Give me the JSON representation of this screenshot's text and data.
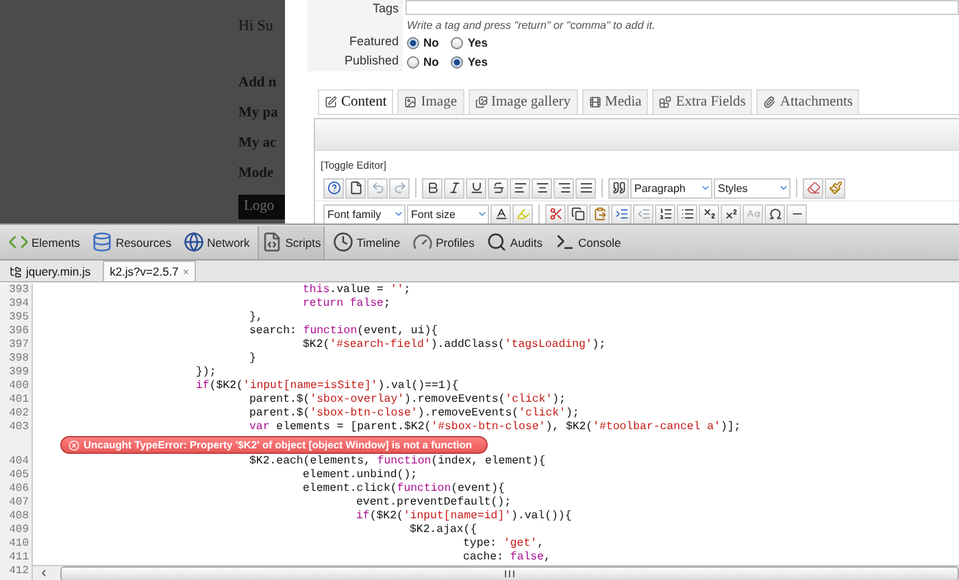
{
  "background_page": {
    "greeting": "Hi Su",
    "links": [
      "Add n",
      "My pa",
      "My ac",
      "Mode"
    ],
    "logout_button": "Logo"
  },
  "item_form": {
    "tags": {
      "label": "Tags",
      "hint": "Write a tag and press \"return\" or \"comma\" to add it."
    },
    "radio_groups": [
      {
        "label": "Featured",
        "options": [
          {
            "label": "No",
            "selected": true
          },
          {
            "label": "Yes",
            "selected": false
          }
        ]
      },
      {
        "label": "Published",
        "options": [
          {
            "label": "No",
            "selected": false
          },
          {
            "label": "Yes",
            "selected": true
          }
        ]
      }
    ],
    "tabs": [
      {
        "label": "Content",
        "selected": true
      },
      {
        "label": "Image",
        "selected": false
      },
      {
        "label": "Image gallery",
        "selected": false
      },
      {
        "label": "Media",
        "selected": false
      },
      {
        "label": "Extra Fields",
        "selected": false
      },
      {
        "label": "Attachments",
        "selected": false
      }
    ],
    "editor": {
      "toggle_link": "[Toggle Editor]",
      "format_select": "Paragraph",
      "styles_select": "Styles",
      "font_family_select": "Font family",
      "font_size_select": "Font size"
    }
  },
  "devtools": {
    "panels": [
      {
        "label": "Elements",
        "selected": false
      },
      {
        "label": "Resources",
        "selected": false
      },
      {
        "label": "Network",
        "selected": false
      },
      {
        "label": "Scripts",
        "selected": true
      },
      {
        "label": "Timeline",
        "selected": false
      },
      {
        "label": "Profiles",
        "selected": false
      },
      {
        "label": "Audits",
        "selected": false
      },
      {
        "label": "Console",
        "selected": false
      }
    ],
    "files": [
      {
        "name": "jquery.min.js",
        "selected": false
      },
      {
        "name": "k2.js?v=2.5.7",
        "selected": true,
        "close": "×"
      }
    ],
    "code_lines": [
      {
        "number": "393",
        "tokens": [
          {
            "kind": "keyword",
            "text": "\t\t\t\t\tthis"
          },
          {
            "kind": "plain",
            "text": ".value = "
          },
          {
            "kind": "string",
            "text": "''"
          },
          {
            "kind": "plain",
            "text": ";"
          }
        ]
      },
      {
        "number": "394",
        "tokens": [
          {
            "kind": "keyword",
            "text": "\t\t\t\t\treturn false"
          },
          {
            "kind": "plain",
            "text": ";"
          }
        ]
      },
      {
        "number": "395",
        "tokens": [
          {
            "kind": "plain",
            "text": "\t\t\t\t},"
          }
        ]
      },
      {
        "number": "396",
        "tokens": [
          {
            "kind": "plain",
            "text": "\t\t\t\tsearch: "
          },
          {
            "kind": "keyword",
            "text": "function"
          },
          {
            "kind": "plain",
            "text": "(event, ui){"
          }
        ]
      },
      {
        "number": "397",
        "tokens": [
          {
            "kind": "plain",
            "text": "\t\t\t\t\t$K2("
          },
          {
            "kind": "string",
            "text": "'#search-field'"
          },
          {
            "kind": "plain",
            "text": ").addClass("
          },
          {
            "kind": "string",
            "text": "'tagsLoading'"
          },
          {
            "kind": "plain",
            "text": ");"
          }
        ]
      },
      {
        "number": "398",
        "tokens": [
          {
            "kind": "plain",
            "text": "\t\t\t\t}"
          }
        ]
      },
      {
        "number": "399",
        "tokens": [
          {
            "kind": "plain",
            "text": "\t\t\t});"
          }
        ]
      },
      {
        "number": "400",
        "tokens": [
          {
            "kind": "keyword",
            "text": "\t\t\tif"
          },
          {
            "kind": "plain",
            "text": "($K2("
          },
          {
            "kind": "string",
            "text": "'input[name=isSite]'"
          },
          {
            "kind": "plain",
            "text": ").val()==1){"
          }
        ]
      },
      {
        "number": "401",
        "tokens": [
          {
            "kind": "plain",
            "text": "\t\t\t\tparent.$("
          },
          {
            "kind": "string",
            "text": "'sbox-overlay'"
          },
          {
            "kind": "plain",
            "text": ").removeEvents("
          },
          {
            "kind": "string",
            "text": "'click'"
          },
          {
            "kind": "plain",
            "text": ");"
          }
        ]
      },
      {
        "number": "402",
        "tokens": [
          {
            "kind": "plain",
            "text": "\t\t\t\tparent.$("
          },
          {
            "kind": "string",
            "text": "'sbox-btn-close'"
          },
          {
            "kind": "plain",
            "text": ").removeEvents("
          },
          {
            "kind": "string",
            "text": "'click'"
          },
          {
            "kind": "plain",
            "text": ");"
          }
        ]
      },
      {
        "number": "403",
        "tokens": [
          {
            "kind": "keyword",
            "text": "\t\t\t\tvar"
          },
          {
            "kind": "plain",
            "text": " elements = [parent.$K2("
          },
          {
            "kind": "string",
            "text": "'#sbox-btn-close'"
          },
          {
            "kind": "plain",
            "text": "), $K2("
          },
          {
            "kind": "string",
            "text": "'#toolbar-cancel a'"
          },
          {
            "kind": "plain",
            "text": ")];"
          }
        ],
        "error": "Uncaught TypeError: Property '$K2' of object [object Window] is not a function"
      },
      {
        "number": "404",
        "tokens": [
          {
            "kind": "plain",
            "text": "\t\t\t\t$K2.each(elements, "
          },
          {
            "kind": "keyword",
            "text": "function"
          },
          {
            "kind": "plain",
            "text": "(index, element){"
          }
        ]
      },
      {
        "number": "405",
        "tokens": [
          {
            "kind": "plain",
            "text": "\t\t\t\t\telement.unbind();"
          }
        ]
      },
      {
        "number": "406",
        "tokens": [
          {
            "kind": "plain",
            "text": "\t\t\t\t\telement.click("
          },
          {
            "kind": "keyword",
            "text": "function"
          },
          {
            "kind": "plain",
            "text": "(event){"
          }
        ]
      },
      {
        "number": "407",
        "tokens": [
          {
            "kind": "plain",
            "text": "\t\t\t\t\t\tevent.preventDefault();"
          }
        ]
      },
      {
        "number": "408",
        "tokens": [
          {
            "kind": "keyword",
            "text": "\t\t\t\t\t\tif"
          },
          {
            "kind": "plain",
            "text": "($K2("
          },
          {
            "kind": "string",
            "text": "'input[name=id]'"
          },
          {
            "kind": "plain",
            "text": ").val()){"
          }
        ]
      },
      {
        "number": "409",
        "tokens": [
          {
            "kind": "plain",
            "text": "\t\t\t\t\t\t\t$K2.ajax({"
          }
        ]
      },
      {
        "number": "410",
        "tokens": [
          {
            "kind": "plain",
            "text": "\t\t\t\t\t\t\t\ttype: "
          },
          {
            "kind": "string",
            "text": "'get'"
          },
          {
            "kind": "plain",
            "text": ","
          }
        ]
      },
      {
        "number": "411",
        "tokens": [
          {
            "kind": "plain",
            "text": "\t\t\t\t\t\t\t\tcache: "
          },
          {
            "kind": "keyword",
            "text": "false"
          },
          {
            "kind": "plain",
            "text": ","
          }
        ]
      }
    ],
    "last_line_number": "412"
  }
}
